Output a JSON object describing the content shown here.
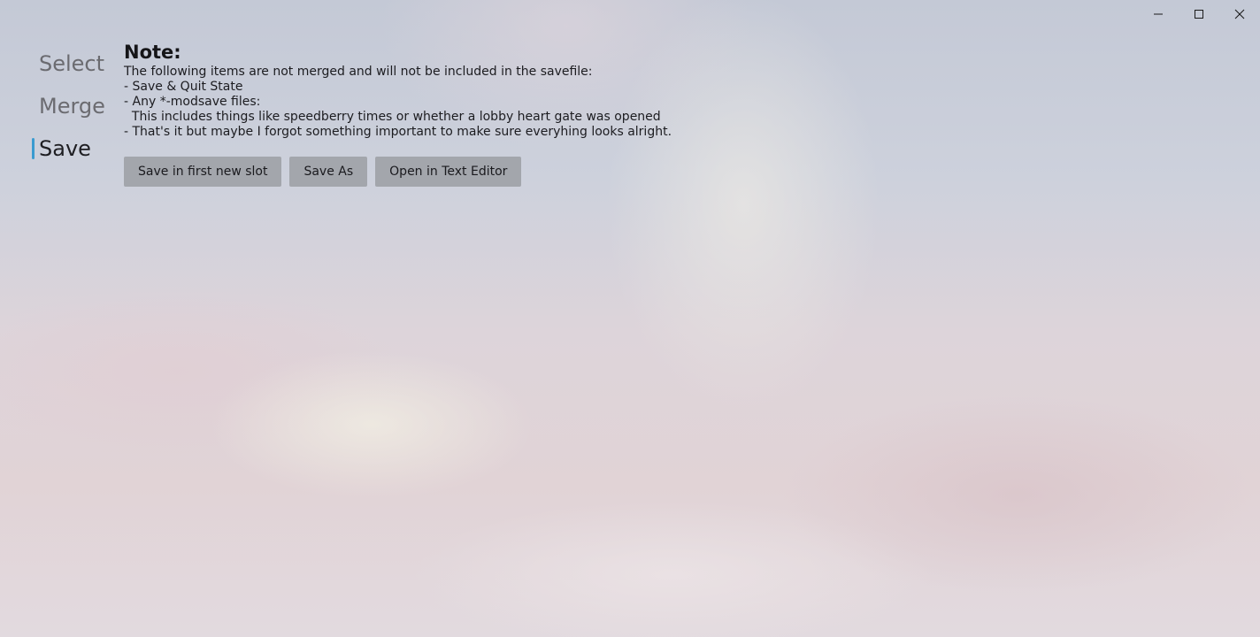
{
  "window": {
    "controls": {
      "minimize": "minimize-icon",
      "maximize": "maximize-icon",
      "close": "close-icon"
    }
  },
  "nav": {
    "items": [
      {
        "label": "Select",
        "selected": false
      },
      {
        "label": "Merge",
        "selected": false
      },
      {
        "label": "Save",
        "selected": true
      }
    ],
    "indicator_color": "#3a9bd0"
  },
  "note": {
    "title": "Note:",
    "lines": [
      "The following items are not merged and will not be included in the savefile:",
      "- Save & Quit State",
      "- Any *-modsave files:",
      "  This includes things like speedberry times or whether a lobby heart gate was opened",
      "- That's it but maybe I forgot something important to make sure everyhing looks alright."
    ]
  },
  "actions": {
    "save_first_new_slot": "Save in first new slot",
    "save_as": "Save As",
    "open_text_editor": "Open in Text Editor"
  },
  "colors": {
    "button_bg": "#a3a6ac",
    "text": "#1c1c20"
  }
}
